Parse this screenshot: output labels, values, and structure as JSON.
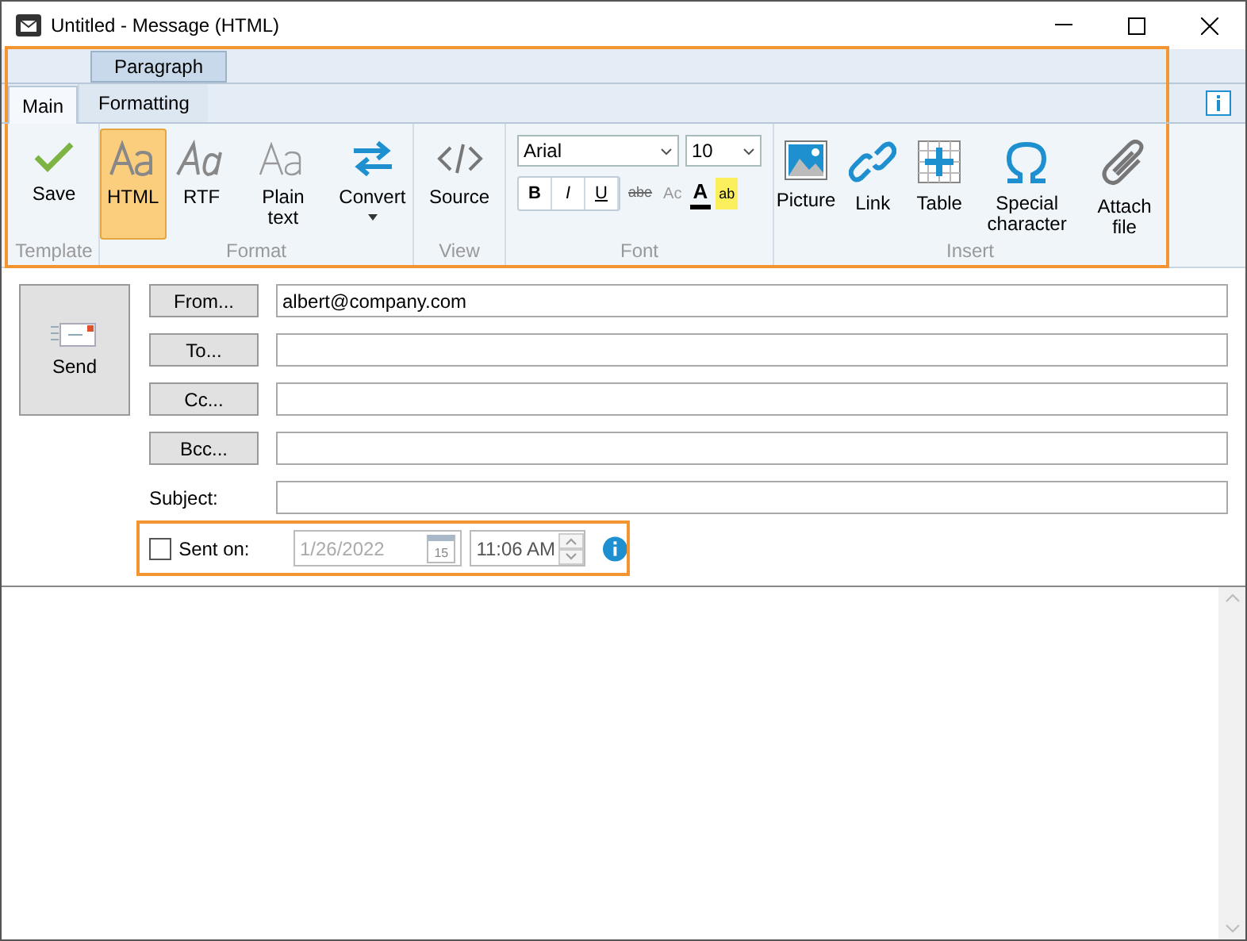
{
  "window": {
    "title": "Untitled - Message (HTML)"
  },
  "ribbon": {
    "context_group": "Paragraph",
    "tabs": [
      {
        "label": "Main",
        "selected": true
      },
      {
        "label": "Formatting",
        "selected": false
      }
    ],
    "groups": [
      {
        "label": "Template",
        "items": [
          {
            "label": "Save",
            "selected": false
          }
        ]
      },
      {
        "label": "Format",
        "items": [
          {
            "label": "HTML",
            "selected": true
          },
          {
            "label": "RTF",
            "selected": false
          },
          {
            "label": "Plain text",
            "selected": false
          },
          {
            "label": "Convert",
            "selected": false
          }
        ]
      },
      {
        "label": "View",
        "items": [
          {
            "label": "Source",
            "selected": false
          }
        ]
      },
      {
        "label": "Font",
        "font_name": "Arial",
        "font_size": "10",
        "format_buttons": [
          "B",
          "I",
          "U"
        ],
        "extra_buttons": [
          "abe",
          "Ac",
          "A",
          "ab"
        ]
      },
      {
        "label": "Insert",
        "items": [
          {
            "label": "Picture",
            "selected": false
          },
          {
            "label": "Link",
            "selected": false
          },
          {
            "label": "Table",
            "selected": false
          },
          {
            "label": "Special character",
            "selected": false
          },
          {
            "label": "Attach file",
            "selected": false
          }
        ]
      }
    ]
  },
  "form": {
    "send": "Send",
    "fields": [
      {
        "button": "From...",
        "value": "albert@company.com"
      },
      {
        "button": "To..."
      },
      {
        "button": "Cc..."
      },
      {
        "button": "Bcc..."
      }
    ],
    "subject_label": "Subject:",
    "sent_on": {
      "label": "Sent on:",
      "checked": false,
      "date": "1/26/2022",
      "calendar_day": "15",
      "time": "11:06 AM"
    }
  }
}
